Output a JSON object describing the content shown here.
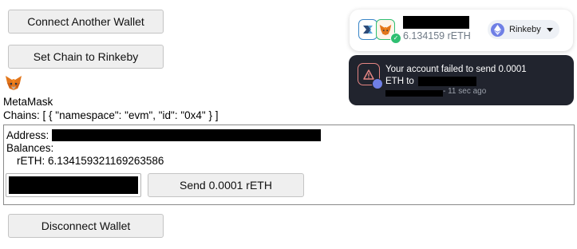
{
  "buttons": {
    "connect_another": "Connect Another Wallet",
    "set_chain": "Set Chain to Rinkeby",
    "send": "Send 0.0001 rETH",
    "disconnect": "Disconnect Wallet"
  },
  "wallet": {
    "icon": "metamask-fox-icon",
    "name": "MetaMask",
    "chains_line": "Chains: [ { \"namespace\": \"evm\", \"id\": \"0x4\" } ]"
  },
  "account": {
    "address_label": "Address:",
    "balances_label": "Balances:",
    "balance_line": "rETH: 6.134159321169263586",
    "send_input_value": ""
  },
  "widget": {
    "balance": "6.134159 rETH",
    "network": "Rinkeby",
    "network_icon": "ethereum-icon",
    "status_icon": "checkmark-icon"
  },
  "toast": {
    "line1": "Your account failed to send 0.0001",
    "line2": "ETH to",
    "time": "- 11 sec ago",
    "icon": "warning-triangle-icon"
  },
  "colors": {
    "toast_bg": "#21242e",
    "toast_error": "#e58583",
    "status_green": "#2fbf71",
    "eth_purple": "#6f7fe5"
  }
}
